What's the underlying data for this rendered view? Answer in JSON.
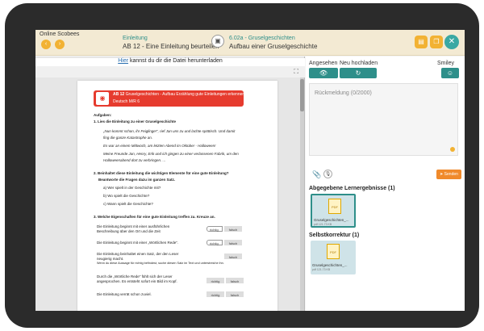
{
  "header": {
    "app_title": "Online Scobees",
    "crumb_link_1": "Einleitung",
    "crumb_text_1": "AB 12 - Eine Einleitung beurteilen",
    "crumb_link_2": "6.02a - Gruselgeschichten",
    "crumb_text_2": "Aufbau einer Gruselgeschichte"
  },
  "left": {
    "download_link": "Hier",
    "download_rest": " kannst du dir die Datei herunterladen"
  },
  "doc": {
    "banner_title": "AB 12",
    "banner_sub": "Gruselgeschichten - Aufbau Erzählung gute Einleitungen erkennen",
    "banner_class": "Deutsch M/R 6",
    "aufgaben": "Aufgaben:",
    "q1": "1. Lies die Einleitung zu einer Gruselgeschichte",
    "story1": "„Nun kommt schon, ihr Feiglinge!\", rief Jan uns zu und lachte spöttisch. Und damit",
    "story2": "fing die ganze Katastrophe an.",
    "story3": "Es war an einem Mittwoch, am letzten Abend im Oktober - Halloween!",
    "story4": "Meine Freunde Jan, Henry, Erik und ich gingen zu einer verlassenen Fabrik, um den",
    "story5": "Halloweenabend dort zu verbringen. ...",
    "q2": "2. Beinhaltet diese Einleitung die wichtigen Elemente für eine gute Einleitung?",
    "q2b": "Beantworte die Fragen dazu im ganzen Satz.",
    "q2a1": "a) Wer spielt in der Geschichte mit?",
    "q2a2": "b) Wo spielt die Geschichte?",
    "q2a3": "c) Wann spielt die Geschichte?",
    "q3": "3. Welche Eigenschaften für eine gute Einleitung treffen zu. Kreuze an.",
    "s1a": "Die Einleitung beginnt mit einer ausführlichen",
    "s1b": "Beschreibung über den Ort und die Zeit",
    "s2": "Die Einleitung beginnt mit einer „Wörtlichen Rede\".",
    "s3a": "Die Einleitung beinhaltet einen Satz, der den Leser",
    "s3b": "neugierig macht.",
    "s3c": "Wenn du diese Aussage für richtig befindest, suche diesen Satz im Text und unterstreiche ihn.",
    "s4a": "Durch die „Wörtliche Rede\" fühlt sich der Leser",
    "s4b": "angesprochen. Es entsteht sofort ein Bild im Kopf.",
    "s5": "Die Einleitung verrät schon zuviel.",
    "richtig": "richtig",
    "falsch": "falsch"
  },
  "right": {
    "label_angesehen": "Angesehen",
    "label_neu": "Neu hochladen",
    "label_smiley": "Smiley",
    "feedback_placeholder": "Rückmeldung (0/2000)",
    "send_label": "Senden",
    "section_submitted": "Abgegebene Lernergebnisse (1)",
    "section_self": "Selbstkorrektur (1)",
    "file_name": "Gruselgeschichten_...",
    "file_size": "pdf 121.73 KB",
    "file_badge": "PDF"
  },
  "colors": {
    "teal": "#2e8f8a",
    "orange": "#f2b233",
    "red": "#e63b2e",
    "send": "#f08a2b"
  }
}
